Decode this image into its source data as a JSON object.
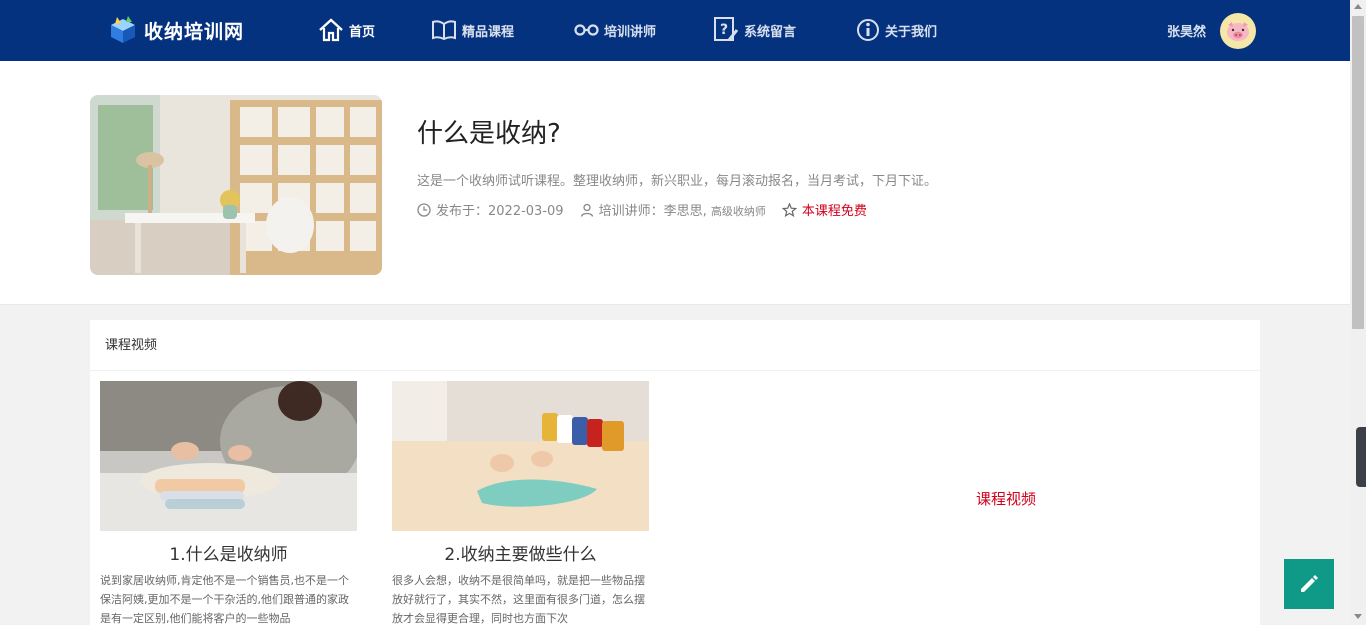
{
  "header": {
    "logo_text": "收纳培训网",
    "nav": [
      {
        "label": "首页",
        "icon": "home-icon",
        "active": true
      },
      {
        "label": "精品课程",
        "icon": "book-icon",
        "active": false
      },
      {
        "label": "培训讲师",
        "icon": "glasses-icon",
        "active": false
      },
      {
        "label": "系统留言",
        "icon": "message-icon",
        "active": false
      },
      {
        "label": "关于我们",
        "icon": "info-icon",
        "active": false
      }
    ],
    "user_name": "张昊然",
    "avatar_icon": "pig-avatar-icon"
  },
  "course": {
    "title": "什么是收纳?",
    "description": "这是一个收纳师试听课程。整理收纳师，新兴职业，每月滚动报名，当月考试，下月下证。",
    "publish_label": "发布于：",
    "publish_date": "2022-03-09",
    "teacher_label": "培训讲师：",
    "teacher_name": "李思思,",
    "teacher_title": "高级收纳师",
    "free_label": "本课程免费"
  },
  "videos": {
    "section_title": "课程视频",
    "side_link": "课程视频",
    "items": [
      {
        "name": "1.什么是收纳师",
        "text": "说到家居收纳师,肯定他不是一个销售员,也不是一个保洁阿姨,更加不是一个干杂活的,他们跟普通的家政是有一定区别,他们能将客户的一些物品"
      },
      {
        "name": "2.收纳主要做些什么",
        "text": "很多人会想，收纳不是很简单吗，就是把一些物品摆放好就行了，其实不然，这里面有很多门道，怎么摆放才会显得更合理，同时也方面下次"
      }
    ]
  },
  "colors": {
    "header_bg": "#05327f",
    "accent_red": "#d0021b",
    "fab_bg": "#0e9a86"
  }
}
